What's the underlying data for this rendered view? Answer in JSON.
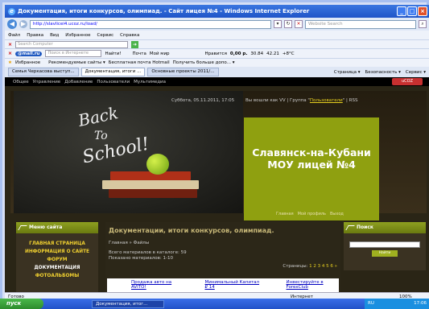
{
  "window": {
    "title": "Документация, итоги конкурсов, олимпиад. - Сайт лицея №4 - Windows Internet Explorer"
  },
  "address": {
    "url": "http://slavlicei4.ucoz.ru/load/",
    "search_placeholder": "Website Search"
  },
  "menubar": [
    "Файл",
    "Правка",
    "Вид",
    "Избранное",
    "Сервис",
    "Справка"
  ],
  "toolbar1": {
    "search_placeholder": "Search Computer"
  },
  "toolbar2": {
    "mailru": "@mail.ru",
    "search_placeholder": "Поиск в Интернете",
    "find": "Найти!",
    "mail": "Почта",
    "myworld": "Мой мир",
    "likes": "Нравится",
    "money": "0,00 р.",
    "usd": "30.84",
    "eur": "42.21",
    "temp": "+8°C"
  },
  "favorites": {
    "label": "Избранное",
    "items": [
      "Рекомендуемые сайты ▾",
      "Бесплатная почта Hotmail",
      "Получить больше допо... ▾"
    ]
  },
  "tabs": [
    {
      "label": "Семья Черкасова выступ..."
    },
    {
      "label": "Документация, итоги ...",
      "active": true
    },
    {
      "label": "Основные проекты 2011/..."
    }
  ],
  "tab_tools": [
    "Страница ▾",
    "Безопасность ▾",
    "Сервис ▾"
  ],
  "ucoz_menu": [
    "Общее",
    "Управление",
    "Добавление",
    "Пользователи",
    "Мультимедиа"
  ],
  "ucoz_logo": "uCOZ",
  "header": {
    "chalk_back": "Back",
    "chalk_to": "To",
    "chalk_school": "School!",
    "date": "Суббота, 05.11.2011, 17:05",
    "login_prefix": "Вы вошли как VV | Группа \"",
    "login_group": "Пользователи",
    "login_suffix": "\" | RSS",
    "site_title": "Славянск-на-Кубани МОУ лицей №4",
    "links": [
      "Главная",
      "Мой профиль",
      "Выход"
    ]
  },
  "left_block": {
    "title": "Меню сайта",
    "items": [
      {
        "label": "ГЛАВНАЯ СТРАНИЦА",
        "yellow": true
      },
      {
        "label": "ИНФОРМАЦИЯ О САЙТЕ",
        "yellow": true
      },
      {
        "label": "ФОРУМ",
        "yellow": true
      },
      {
        "label": "ДОКУМЕНТАЦИЯ",
        "yellow": false
      },
      {
        "label": "ФОТОАЛЬБОМЫ",
        "yellow": true
      }
    ]
  },
  "center": {
    "heading": "Документации, итоги конкурсов, олимпиад.",
    "crumbs": "Главная » Файлы",
    "total": "Всего материалов в каталоге: 59",
    "shown": "Показано материалов: 1-10",
    "pages_label": "Страницы:",
    "pages": "1 2 3 4 5 6 »",
    "ads": [
      "Продажа авто на AVITO!",
      "Минимальный Капитал ₽ 14",
      "Инвестируйте в ForexClub"
    ]
  },
  "right_block": {
    "title": "Поиск",
    "button": "Найти"
  },
  "status": {
    "text": "Готово",
    "zone": "Интернет",
    "zoom": "100%"
  },
  "taskbar": {
    "start": "пуск",
    "task": "Документация, итог...",
    "lang": "RU",
    "clock": "17:06"
  }
}
